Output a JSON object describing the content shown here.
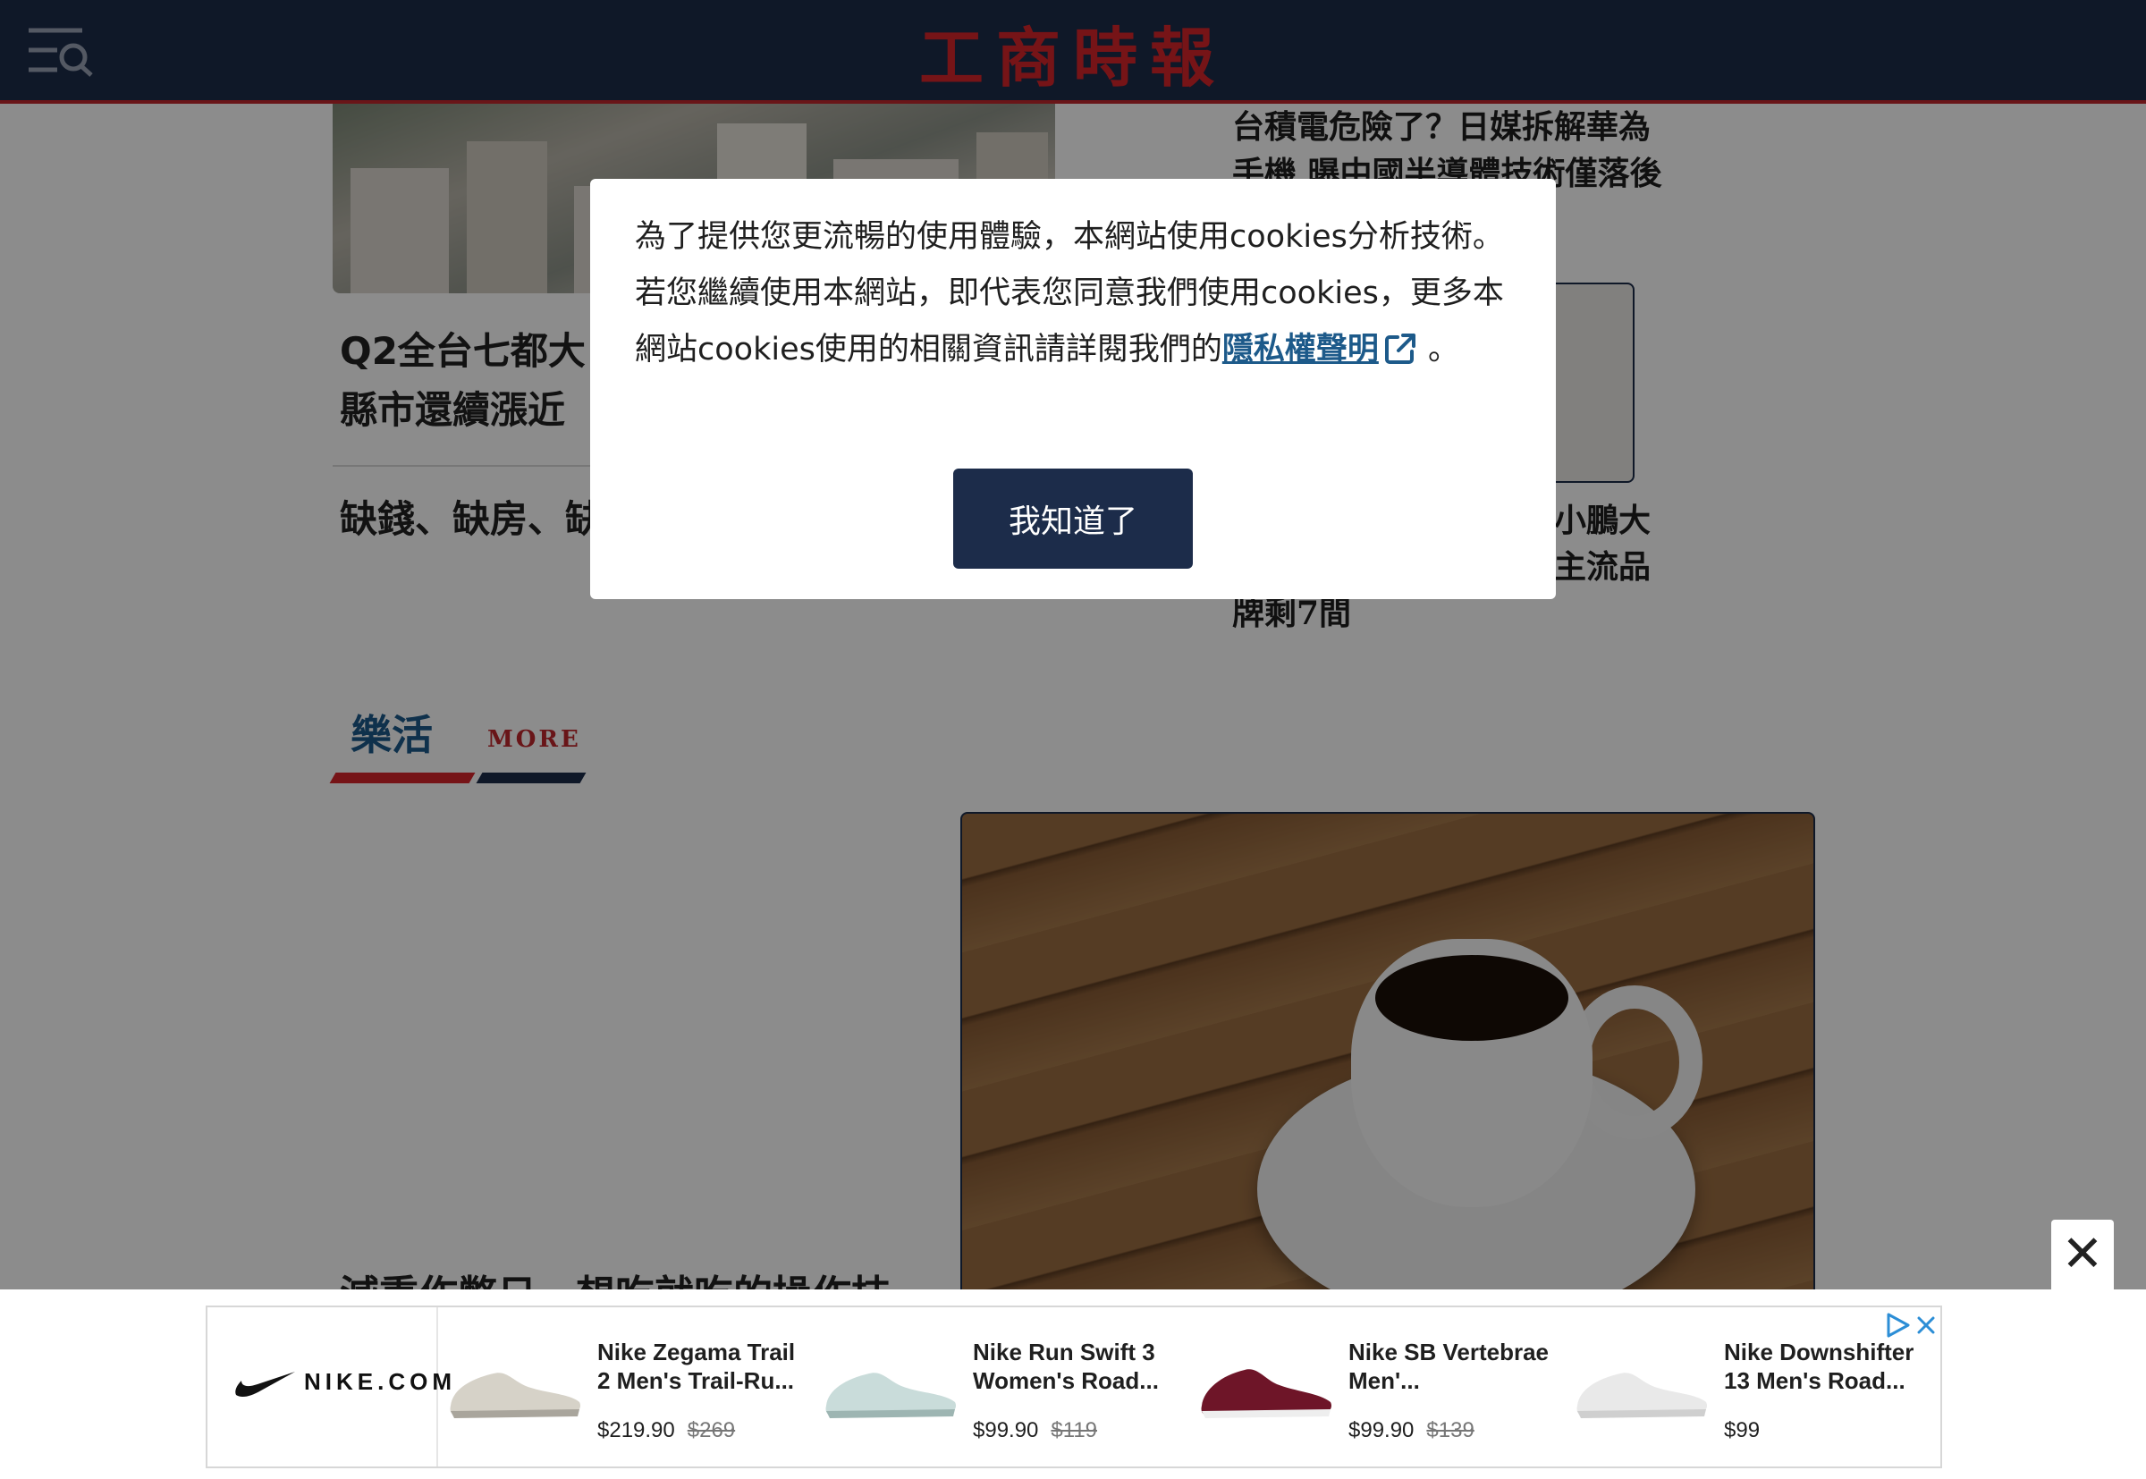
{
  "header": {
    "logo": "工商時報"
  },
  "articles": {
    "main_title_line1": "Q2全台七都大",
    "main_title_line2": "縣市還續漲近",
    "second_title": "缺錢、缺房、缺",
    "right_top_line1": "台積電危險了？日媒拆解華為",
    "right_top_line2": "手機 曝中國半導體技術僅落後",
    "right_bottom_line1": "小鵬大",
    "right_bottom_line2": "主流品",
    "right_bottom_line3": "牌剩7間"
  },
  "lifestyle": {
    "label": "樂活",
    "more": "MORE",
    "title": "減重作弊日，想吃就吃的操作技巧"
  },
  "cookie": {
    "text": "為了提供您更流暢的使用體驗，本網站使用cookies分析技術。若您繼續使用本網站，即代表您同意我們使用cookies，更多本網站cookies使用的相關資訊請詳閱我們的",
    "link": "隱私權聲明",
    "tail": " 。",
    "button": "我知道了"
  },
  "ad": {
    "close_symbol": "✕",
    "brand": "NIKE.COM",
    "items": [
      {
        "title": "Nike Zegama Trail 2 Men's Trail-Ru...",
        "price": "$219.90",
        "old_price": "$269"
      },
      {
        "title": "Nike Run Swift 3 Women's Road...",
        "price": "$99.90",
        "old_price": "$119"
      },
      {
        "title": "Nike SB Vertebrae Men'...",
        "price": "$99.90",
        "old_price": "$139"
      },
      {
        "title": "Nike Downshifter 13 Men's Road...",
        "price": "$99",
        "old_price": ""
      }
    ]
  },
  "colors": {
    "navy": "#1c2c4a",
    "red": "#d8252b",
    "link_blue": "#1d5a8a"
  }
}
